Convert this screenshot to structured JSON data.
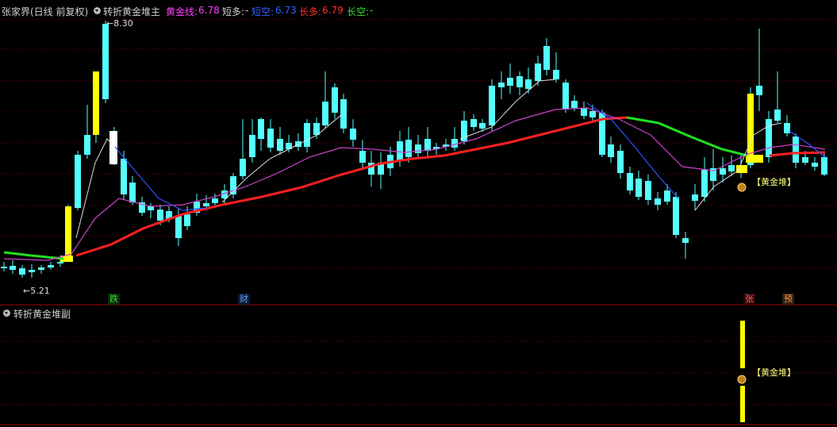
{
  "header": {
    "stock": "张家界",
    "period": "(日线 前复权)",
    "indicator_main": "转折黄金堆主",
    "gold_label": "黄金线:",
    "gold_value": "6.78",
    "short_bull_label": "短多:",
    "short_bull_value": "-",
    "short_bear_label": "短空:",
    "short_bear_value": "6.73",
    "long_bull_label": "长多:",
    "long_bull_value": "6.79",
    "long_bear_label": "长空:",
    "long_bear_value": "-"
  },
  "sub": {
    "indicator": "转折黄金堆副"
  },
  "annotations": {
    "high_price": "8.30",
    "low_price": "5.21",
    "gold_pile": "【黄金堆】",
    "gold_pile_sub": "【黄金堆】"
  },
  "markers": {
    "die": "跌",
    "cai": "财",
    "zhang": "张",
    "yu": "预"
  },
  "colors": {
    "up": "#ff4040",
    "down": "#54ffff",
    "gold": "#ffff00",
    "ma_long_red": "#ff2020",
    "ma_long_green": "#20e020",
    "ma_purple": "#cc44cc",
    "ma_blue": "#3050ff",
    "ma_white": "#dddddd",
    "grid": "#800000"
  }
}
